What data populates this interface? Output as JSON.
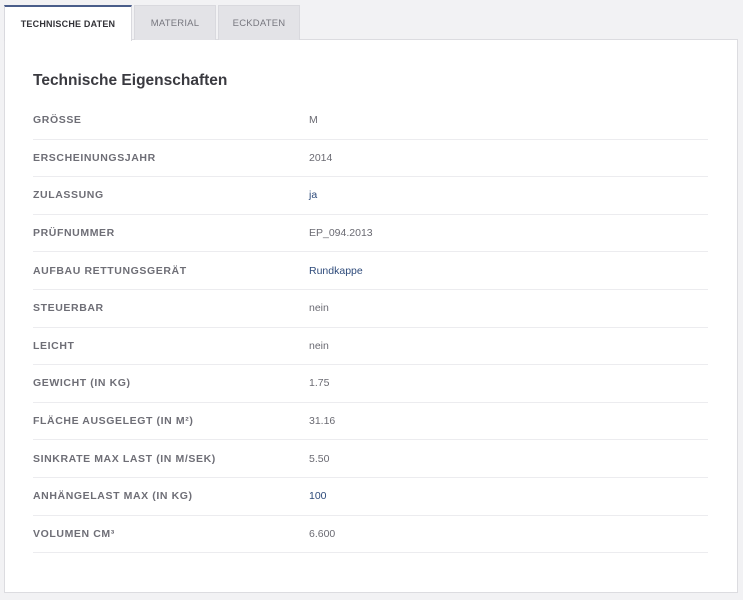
{
  "tabs": [
    {
      "label": "TECHNISCHE DATEN",
      "active": true
    },
    {
      "label": "MATERIAL",
      "active": false
    },
    {
      "label": "ECKDATEN",
      "active": false
    }
  ],
  "section": {
    "title": "Technische Eigenschaften"
  },
  "specs": [
    {
      "label": "GRÖSSE",
      "value": "M"
    },
    {
      "label": "ERSCHEINUNGSJAHR",
      "value": "2014"
    },
    {
      "label": "ZULASSUNG",
      "value": "ja"
    },
    {
      "label": "PRÜFNUMMER",
      "value": "EP_094.2013"
    },
    {
      "label": "AUFBAU RETTUNGSGERÄT",
      "value": "Rundkappe"
    },
    {
      "label": "STEUERBAR",
      "value": "nein"
    },
    {
      "label": "LEICHT",
      "value": "nein"
    },
    {
      "label": "GEWICHT (IN KG)",
      "value": "1.75"
    },
    {
      "label": "FLÄCHE AUSGELEGT (IN M²)",
      "value": "31.16"
    },
    {
      "label": "SINKRATE MAX LAST (IN M/SEK)",
      "value": "5.50"
    },
    {
      "label": "ANHÄNGELAST MAX (IN KG)",
      "value": "100"
    },
    {
      "label": "VOLUMEN CM³",
      "value": "6.600"
    }
  ],
  "colors": {
    "accent": "#4a5d8a",
    "link": "#2d4a7a",
    "text_muted": "#6e6e76"
  }
}
